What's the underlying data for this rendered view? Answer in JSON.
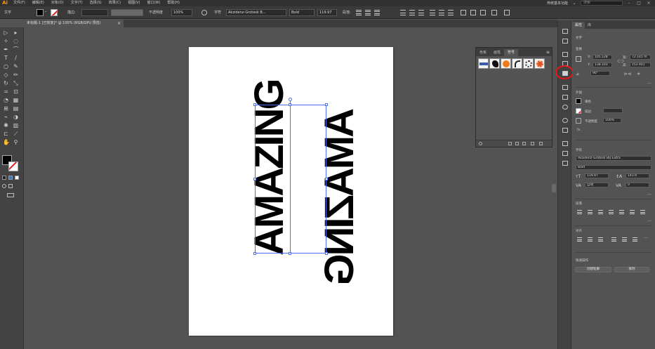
{
  "menubar": {
    "logo": "Ai",
    "items": [
      "文件(F)",
      "编辑(E)",
      "对象(O)",
      "文字(T)",
      "选择(S)",
      "效果(C)",
      "视图(V)",
      "窗口(W)",
      "帮助(H)"
    ],
    "workspace": "传统基本功能",
    "search_placeholder": "搜索"
  },
  "controlbar": {
    "object_type": "文字",
    "stroke_label": "描边:",
    "opacity_label": "不透明度",
    "opacity_value": "100%",
    "char_label": "字符",
    "font_family": "Akzidenz-Grotesk B...",
    "font_style": "Bold",
    "font_size": "119.97 ",
    "para_label": "段落:"
  },
  "document": {
    "tab_title": "未标题-1 [已恢复]* @ 100% (RGB/GPU 预览)",
    "artwork_text_left": "AMAZING",
    "artwork_text_right": "AMAZING"
  },
  "symbols_panel": {
    "tabs": [
      "色板",
      "画笔",
      "符号"
    ],
    "active_tab": "符号",
    "symbol_count": 6
  },
  "properties_panel": {
    "tabs": [
      "属性",
      "库"
    ],
    "section_type": "文字",
    "transform_title": "变换",
    "x_label": "X:",
    "x_value": "105.128",
    "y_label": "Y:",
    "y_value": "138.103",
    "w_label": "宽:",
    "w_value": "72.141 m",
    "h_label": "高:",
    "h_value": "152.401",
    "angle_value": "90°",
    "appearance_title": "外观",
    "fill_label": "填色",
    "stroke_label": "描边",
    "opacity_label": "不透明度",
    "opacity_value": "100%",
    "fx_label": "fx.",
    "char_title": "字符",
    "font_family": "Akzidenz-Grotesk BQ Extra",
    "font_style": "Bold",
    "font_size": "119.97",
    "leading": "143.9",
    "tracking_label": "自动",
    "kerning": "0",
    "para_title": "段落",
    "align_title": "对齐",
    "quick_title": "快速操作",
    "btn_outline": "创建轮廓",
    "btn_arrange": "排列"
  },
  "colors": {
    "accent": "#4d6ef5",
    "highlight": "#e01818"
  }
}
